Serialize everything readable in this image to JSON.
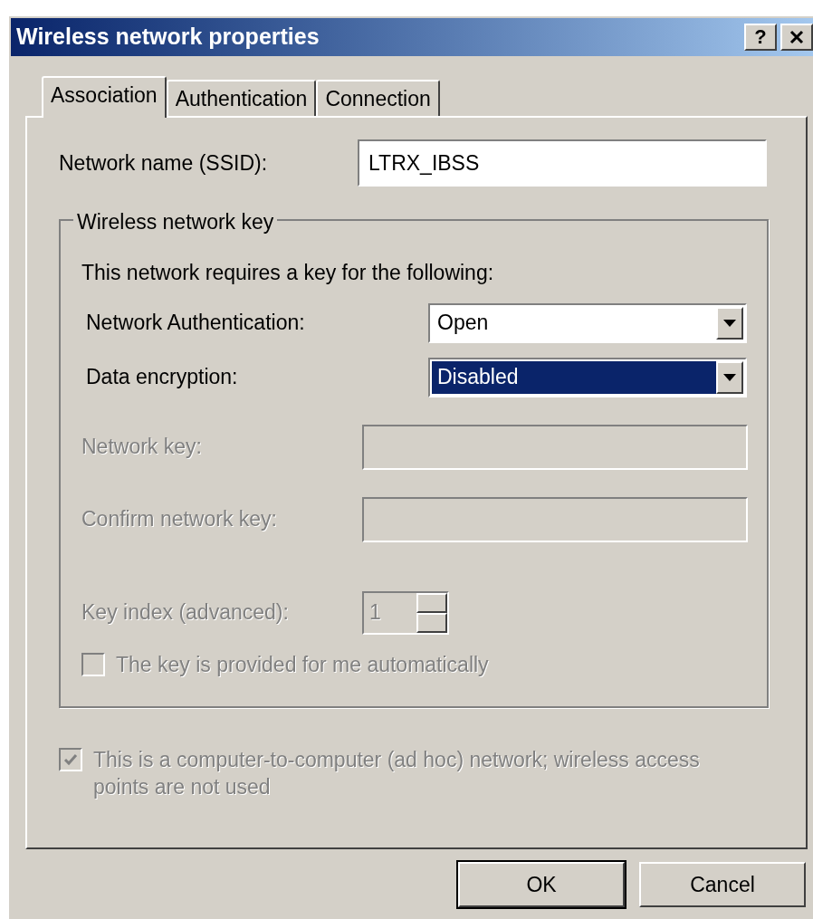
{
  "window": {
    "title": "Wireless network properties",
    "help_button": "?"
  },
  "tabs": [
    {
      "label": "Association",
      "selected": true
    },
    {
      "label": "Authentication",
      "selected": false
    },
    {
      "label": "Connection",
      "selected": false
    }
  ],
  "ssid": {
    "label": "Network name (SSID):",
    "value": "LTRX_IBSS"
  },
  "key_group": {
    "title": "Wireless network key",
    "intro": "This network requires a key for the following:",
    "dropdowns": [
      {
        "label": "Network Authentication:",
        "value": "Open",
        "focused": false
      },
      {
        "label": "Data encryption:",
        "value": "Disabled",
        "focused": true
      }
    ],
    "key_fields": [
      {
        "label": "Network key:",
        "disabled": true
      },
      {
        "label": "Confirm network key:",
        "disabled": true
      }
    ],
    "key_index": {
      "label": "Key index (advanced):",
      "value": "1",
      "disabled": true
    },
    "auto_key": {
      "label": "The key is provided for me automatically",
      "checked": false,
      "disabled": true
    }
  },
  "adhoc": {
    "label": "This is a computer-to-computer (ad hoc) network; wireless access points are not used",
    "checked": true,
    "disabled": true
  },
  "buttons": [
    {
      "label": "OK",
      "default": true
    },
    {
      "label": "Cancel",
      "default": false
    }
  ]
}
